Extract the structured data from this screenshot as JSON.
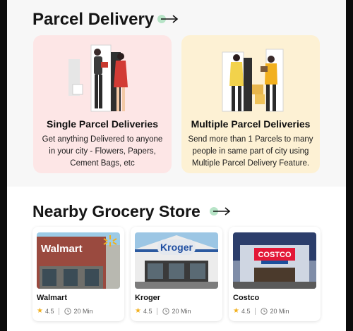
{
  "sections": {
    "parcel_title": "Parcel Delivery",
    "grocery_title": "Nearby Grocery Store"
  },
  "delivery_cards": [
    {
      "title": "Single Parcel Deliveries",
      "description": "Get anything Delivered to anyone in your city - Flowers, Papers, Cement Bags, etc",
      "bg": "#fde6e6"
    },
    {
      "title": "Multiple Parcel Deliveries",
      "description": "Send more than 1 Parcels to many people in same part  of city using Multiple Parcel Delivery Feature.",
      "bg": "#fdf1d4"
    }
  ],
  "stores": [
    {
      "name": "Walmart",
      "rating": "4.5",
      "time": "20 Min",
      "sign": "Walmart"
    },
    {
      "name": "Kroger",
      "rating": "4.5",
      "time": "20 Min",
      "sign": "Kroger"
    },
    {
      "name": "Costco",
      "rating": "4.5",
      "time": "20 Min",
      "sign": "COSTCO"
    }
  ],
  "colors": {
    "accent_green": "#b7e4c7",
    "star": "#f2b01e",
    "text": "#151515"
  }
}
